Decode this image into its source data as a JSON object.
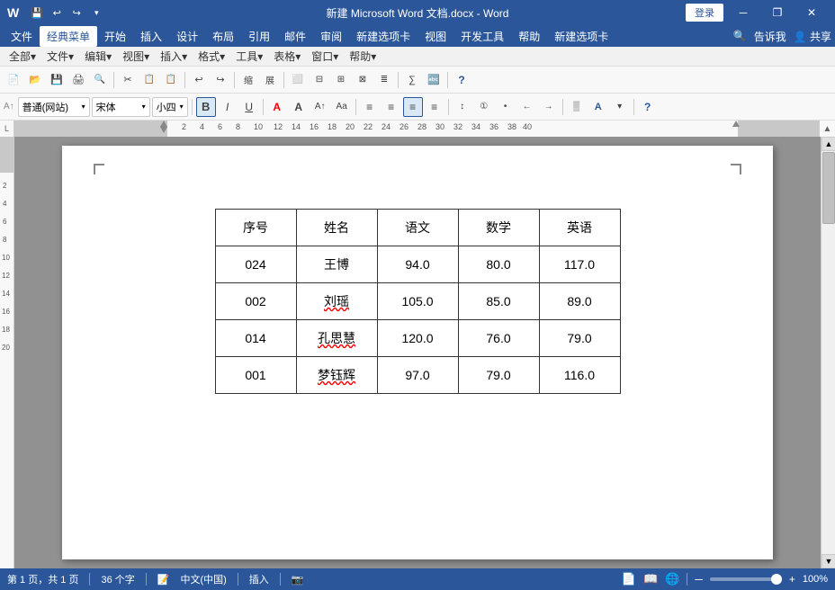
{
  "titleBar": {
    "title": "新建 Microsoft Word 文档.docx - Word",
    "loginBtn": "登录",
    "windowControls": {
      "minimize": "─",
      "restore": "❐",
      "close": "✕"
    }
  },
  "quickAccess": {
    "save": "💾",
    "undo": "↩",
    "redo": "↪",
    "customize": "▾"
  },
  "menuBar": {
    "items": [
      {
        "label": "文件",
        "active": false
      },
      {
        "label": "经典菜单",
        "active": true
      },
      {
        "label": "开始",
        "active": false
      },
      {
        "label": "插入",
        "active": false
      },
      {
        "label": "设计",
        "active": false
      },
      {
        "label": "布局",
        "active": false
      },
      {
        "label": "引用",
        "active": false
      },
      {
        "label": "邮件",
        "active": false
      },
      {
        "label": "审阅",
        "active": false
      },
      {
        "label": "新建选项卡",
        "active": false
      },
      {
        "label": "视图",
        "active": false
      },
      {
        "label": "开发工具",
        "active": false
      },
      {
        "label": "帮助",
        "active": false
      },
      {
        "label": "新建选项卡",
        "active": false
      }
    ],
    "rightItems": [
      "🔍",
      "告诉我",
      "👤 共享"
    ]
  },
  "classicMenu": {
    "items": [
      {
        "label": "全部▾"
      },
      {
        "label": "文件▾"
      },
      {
        "label": "编辑▾"
      },
      {
        "label": "视图▾"
      },
      {
        "label": "插入▾"
      },
      {
        "label": "格式▾"
      },
      {
        "label": "工具▾"
      },
      {
        "label": "表格▾"
      },
      {
        "label": "窗口▾"
      },
      {
        "label": "帮助▾"
      }
    ]
  },
  "toolbar": {
    "buttons": [
      "📄",
      "📂",
      "💾",
      "🖨️",
      "🔍",
      "✂️",
      "📋",
      "↩",
      "↪",
      "🔠",
      "🔍",
      "⬛",
      "⬜",
      "≡",
      "⊟",
      "⊞",
      "⊠",
      "≣",
      "A",
      "∑",
      "🔤",
      "?"
    ]
  },
  "formatBar": {
    "style": "普通(网站)",
    "font": "宋体",
    "size": "小四",
    "bold": "B",
    "italic": "I",
    "underline": "U",
    "fontColor": "A",
    "align": [
      "≡",
      "≡",
      "≡",
      "≡"
    ],
    "indent": [
      "←",
      "→"
    ],
    "list": [
      "≡",
      "≡"
    ],
    "other": [
      "▾",
      "🖊",
      "A",
      "?"
    ]
  },
  "table": {
    "headers": [
      "序号",
      "姓名",
      "语文",
      "数学",
      "英语"
    ],
    "rows": [
      {
        "id": "024",
        "name": "王博",
        "chinese": "94.0",
        "math": "80.0",
        "english": "117.0",
        "nameStyle": "normal"
      },
      {
        "id": "002",
        "name": "刘瑶",
        "chinese": "105.0",
        "math": "85.0",
        "english": "89.0",
        "nameStyle": "underline"
      },
      {
        "id": "014",
        "name": "孔思慧",
        "chinese": "120.0",
        "math": "76.0",
        "english": "79.0",
        "nameStyle": "underline"
      },
      {
        "id": "001",
        "name": "梦钰辉",
        "chinese": "97.0",
        "math": "79.0",
        "english": "116.0",
        "nameStyle": "underline"
      }
    ]
  },
  "statusBar": {
    "page": "第 1 页，共 1 页",
    "wordCount": "36 个字",
    "language": "中文(中国)",
    "mode": "插入",
    "zoom": "100%",
    "zoomLevel": 100
  }
}
